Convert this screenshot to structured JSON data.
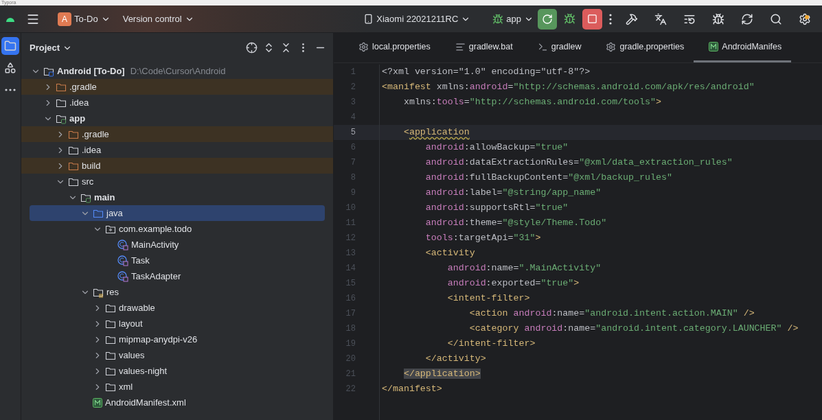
{
  "window": {
    "title": "Typora"
  },
  "toolbar": {
    "project": {
      "badge": "A",
      "name": "To-Do"
    },
    "vcs": "Version control",
    "device": "Xiaomi 22021211RC",
    "run_config": "app",
    "actions": [
      {
        "kind": "rerun"
      },
      {
        "kind": "debug"
      },
      {
        "kind": "stop"
      },
      {
        "kind": "more"
      },
      {
        "kind": "build"
      },
      {
        "kind": "translate"
      },
      {
        "kind": "list"
      },
      {
        "kind": "profiler"
      },
      {
        "kind": "sync"
      },
      {
        "kind": "search"
      },
      {
        "kind": "settings",
        "badge": true
      }
    ]
  },
  "stripe": [
    {
      "kind": "project",
      "selected": true
    },
    {
      "kind": "structure",
      "selected": false
    },
    {
      "kind": "more",
      "selected": false
    }
  ],
  "project_panel": {
    "title": "Project",
    "tree": [
      {
        "label": "Android **[To-Do]**",
        "path": "D:\\Code\\Cursor\\Android",
        "kind": "module",
        "expanded": true,
        "selected": false,
        "children": [
          {
            "label": ".gradle",
            "kind": "excluded",
            "expanded": false,
            "selected": false
          },
          {
            "label": ".idea",
            "kind": "folder",
            "expanded": false,
            "selected": false
          },
          {
            "label": "app",
            "kind": "module",
            "expanded": true,
            "selected": false,
            "children": [
              {
                "label": ".gradle",
                "kind": "excluded",
                "expanded": false,
                "selected": false
              },
              {
                "label": ".idea",
                "kind": "folder",
                "expanded": false,
                "selected": false
              },
              {
                "label": "build",
                "kind": "excluded",
                "expanded": false,
                "selected": false
              },
              {
                "label": "src",
                "kind": "folder",
                "expanded": true,
                "selected": false,
                "children": [
                  {
                    "label": "main",
                    "kind": "module",
                    "expanded": true,
                    "selected": false,
                    "children": [
                      {
                        "label": "java",
                        "kind": "source",
                        "expanded": true,
                        "selected": true,
                        "children": [
                          {
                            "label": "com.example.todo",
                            "kind": "package",
                            "expanded": true,
                            "selected": false,
                            "children": [
                              {
                                "label": "MainActivity",
                                "kind": "class",
                                "selected": false
                              },
                              {
                                "label": "Task",
                                "kind": "class",
                                "selected": false
                              },
                              {
                                "label": "TaskAdapter",
                                "kind": "class",
                                "selected": false
                              }
                            ]
                          }
                        ]
                      },
                      {
                        "label": "res",
                        "kind": "res",
                        "expanded": true,
                        "selected": false,
                        "children": [
                          {
                            "label": "drawable",
                            "kind": "folder",
                            "expanded": false,
                            "selected": false
                          },
                          {
                            "label": "layout",
                            "kind": "folder",
                            "expanded": false,
                            "selected": false
                          },
                          {
                            "label": "mipmap-anydpi-v26",
                            "kind": "folder",
                            "expanded": false,
                            "selected": false
                          },
                          {
                            "label": "values",
                            "kind": "folder",
                            "expanded": false,
                            "selected": false
                          },
                          {
                            "label": "values-night",
                            "kind": "folder",
                            "expanded": false,
                            "selected": false
                          },
                          {
                            "label": "xml",
                            "kind": "folder",
                            "expanded": false,
                            "selected": false
                          }
                        ]
                      },
                      {
                        "label": "AndroidManifest.xml",
                        "kind": "manifest",
                        "selected": false
                      }
                    ]
                  }
                ]
              }
            ]
          }
        ]
      }
    ]
  },
  "tabs": [
    {
      "label": "local.properties",
      "kind": "properties",
      "selected": false
    },
    {
      "label": "gradlew.bat",
      "kind": "text",
      "selected": false
    },
    {
      "label": "gradlew",
      "kind": "shell",
      "selected": false
    },
    {
      "label": "gradle.properties",
      "kind": "properties",
      "selected": false
    },
    {
      "label": "AndroidManifes",
      "kind": "manifest",
      "selected": true
    }
  ],
  "editor": {
    "lines": [
      {
        "number": "1",
        "current": false,
        "tokens": [
          {
            "text": "<?xml version=\"1.0\" encoding=\"utf-8\"?>",
            "kind": "attr"
          }
        ]
      },
      {
        "number": "2",
        "current": false,
        "tokens": [
          {
            "text": "<manifest",
            "kind": "tag"
          },
          {
            "text": " xmlns:",
            "kind": "attr"
          },
          {
            "text": "android",
            "kind": "ns"
          },
          {
            "text": "=",
            "kind": "attr"
          },
          {
            "text": "\"http://schemas.android.com/apk/res/android\"",
            "kind": "str"
          }
        ]
      },
      {
        "number": "3",
        "current": false,
        "tokens": [
          {
            "text": "    xmlns:",
            "kind": "attr"
          },
          {
            "text": "tools",
            "kind": "ns"
          },
          {
            "text": "=",
            "kind": "attr"
          },
          {
            "text": "\"http://schemas.android.com/tools\"",
            "kind": "str"
          },
          {
            "text": ">",
            "kind": "tag"
          }
        ]
      },
      {
        "number": "4",
        "current": false
      },
      {
        "number": "5",
        "current": true,
        "tokens": [
          {
            "text": "    <",
            "kind": "tag"
          },
          {
            "text": "application",
            "kind": "warn"
          }
        ]
      },
      {
        "number": "6",
        "current": false,
        "tokens": [
          {
            "text": "        android",
            "kind": "ns"
          },
          {
            "text": ":allowBackup=",
            "kind": "attr"
          },
          {
            "text": "\"true\"",
            "kind": "str"
          }
        ]
      },
      {
        "number": "7",
        "current": false,
        "tokens": [
          {
            "text": "        android",
            "kind": "ns"
          },
          {
            "text": ":dataExtractionRules=",
            "kind": "attr"
          },
          {
            "text": "\"@xml/data_extraction_rules\"",
            "kind": "str"
          }
        ]
      },
      {
        "number": "8",
        "current": false,
        "tokens": [
          {
            "text": "        android",
            "kind": "ns"
          },
          {
            "text": ":fullBackupContent=",
            "kind": "attr"
          },
          {
            "text": "\"@xml/backup_rules\"",
            "kind": "str"
          }
        ]
      },
      {
        "number": "9",
        "current": false,
        "tokens": [
          {
            "text": "        android",
            "kind": "ns"
          },
          {
            "text": ":label=",
            "kind": "attr"
          },
          {
            "text": "\"@string/app_name\"",
            "kind": "str"
          }
        ]
      },
      {
        "number": "10",
        "current": false,
        "tokens": [
          {
            "text": "        android",
            "kind": "ns"
          },
          {
            "text": ":supportsRtl=",
            "kind": "attr"
          },
          {
            "text": "\"true\"",
            "kind": "str"
          }
        ]
      },
      {
        "number": "11",
        "current": false,
        "tokens": [
          {
            "text": "        android",
            "kind": "ns"
          },
          {
            "text": ":theme=",
            "kind": "attr"
          },
          {
            "text": "\"@style/Theme.Todo\"",
            "kind": "str"
          }
        ]
      },
      {
        "number": "12",
        "current": false,
        "tokens": [
          {
            "text": "        tools",
            "kind": "ns"
          },
          {
            "text": ":targetApi=",
            "kind": "attr"
          },
          {
            "text": "\"31\"",
            "kind": "str"
          },
          {
            "text": ">",
            "kind": "tag"
          }
        ]
      },
      {
        "number": "13",
        "current": false,
        "tokens": [
          {
            "text": "        <activity",
            "kind": "tag"
          }
        ]
      },
      {
        "number": "14",
        "current": false,
        "tokens": [
          {
            "text": "            android",
            "kind": "ns"
          },
          {
            "text": ":name=",
            "kind": "attr"
          },
          {
            "text": "\".MainActivity\"",
            "kind": "str"
          }
        ]
      },
      {
        "number": "15",
        "current": false,
        "tokens": [
          {
            "text": "            android",
            "kind": "ns"
          },
          {
            "text": ":exported=",
            "kind": "attr"
          },
          {
            "text": "\"true\"",
            "kind": "str"
          },
          {
            "text": ">",
            "kind": "tag"
          }
        ]
      },
      {
        "number": "16",
        "current": false,
        "tokens": [
          {
            "text": "            <intent-filter>",
            "kind": "tag"
          }
        ]
      },
      {
        "number": "17",
        "current": false,
        "tokens": [
          {
            "text": "                <action ",
            "kind": "tag"
          },
          {
            "text": "android",
            "kind": "ns"
          },
          {
            "text": ":name=",
            "kind": "attr"
          },
          {
            "text": "\"android.intent.action.MAIN\"",
            "kind": "str"
          },
          {
            "text": " />",
            "kind": "tag"
          }
        ]
      },
      {
        "number": "18",
        "current": false,
        "tokens": [
          {
            "text": "                <category ",
            "kind": "tag"
          },
          {
            "text": "android",
            "kind": "ns"
          },
          {
            "text": ":name=",
            "kind": "attr"
          },
          {
            "text": "\"android.intent.category.LAUNCHER\"",
            "kind": "str"
          },
          {
            "text": " />",
            "kind": "tag"
          }
        ]
      },
      {
        "number": "19",
        "current": false,
        "tokens": [
          {
            "text": "            </intent-filter>",
            "kind": "tag"
          }
        ]
      },
      {
        "number": "20",
        "current": false,
        "tokens": [
          {
            "text": "        </activity>",
            "kind": "tag"
          }
        ]
      },
      {
        "number": "21",
        "current": false,
        "tokens": [
          {
            "text": "    </application>",
            "kind": "match"
          }
        ]
      },
      {
        "number": "22",
        "current": false,
        "tokens": [
          {
            "text": "</manifest>",
            "kind": "tag"
          }
        ]
      }
    ]
  }
}
